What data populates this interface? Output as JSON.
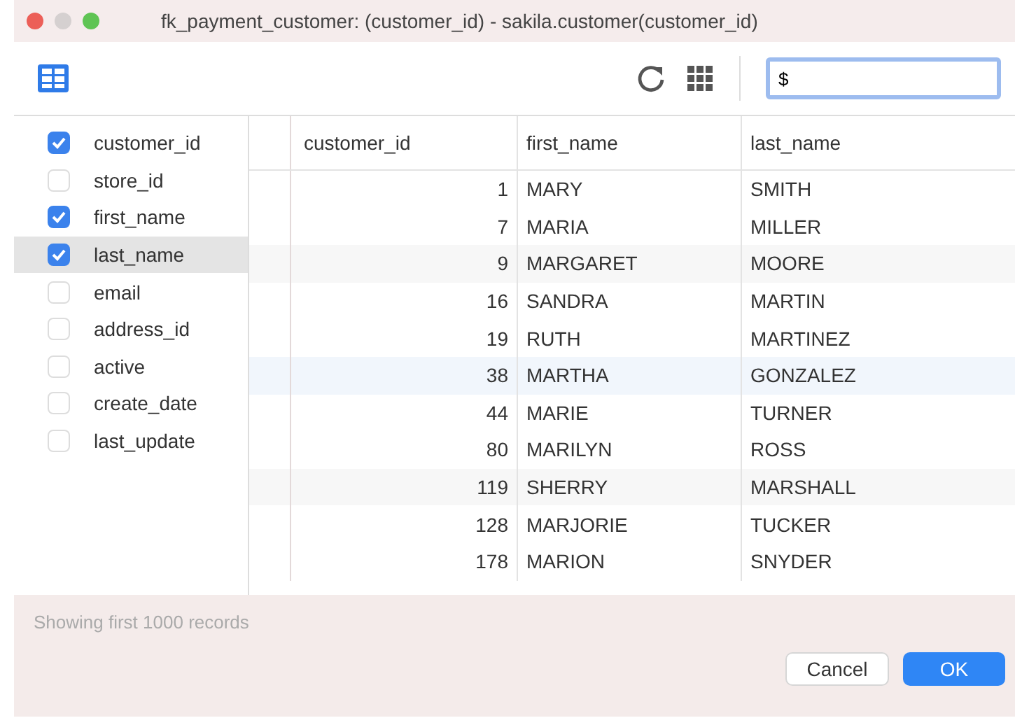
{
  "window": {
    "title": "fk_payment_customer: (customer_id) - sakila.customer(customer_id)"
  },
  "search": {
    "value": "$"
  },
  "columns": [
    {
      "name": "customer_id",
      "checked": true,
      "selected": false
    },
    {
      "name": "store_id",
      "checked": false,
      "selected": false
    },
    {
      "name": "first_name",
      "checked": true,
      "selected": false
    },
    {
      "name": "last_name",
      "checked": true,
      "selected": true
    },
    {
      "name": "email",
      "checked": false,
      "selected": false
    },
    {
      "name": "address_id",
      "checked": false,
      "selected": false
    },
    {
      "name": "active",
      "checked": false,
      "selected": false
    },
    {
      "name": "create_date",
      "checked": false,
      "selected": false
    },
    {
      "name": "last_update",
      "checked": false,
      "selected": false
    }
  ],
  "table": {
    "columns": [
      "customer_id",
      "first_name",
      "last_name"
    ],
    "rows": [
      [
        "1",
        "MARY",
        "SMITH"
      ],
      [
        "7",
        "MARIA",
        "MILLER"
      ],
      [
        "9",
        "MARGARET",
        "MOORE"
      ],
      [
        "16",
        "SANDRA",
        "MARTIN"
      ],
      [
        "19",
        "RUTH",
        "MARTINEZ"
      ],
      [
        "38",
        "MARTHA",
        "GONZALEZ"
      ],
      [
        "44",
        "MARIE",
        "TURNER"
      ],
      [
        "80",
        "MARILYN",
        "ROSS"
      ],
      [
        "119",
        "SHERRY",
        "MARSHALL"
      ],
      [
        "128",
        "MARJORIE",
        "TUCKER"
      ],
      [
        "178",
        "MARION",
        "SNYDER"
      ]
    ]
  },
  "status": "Showing first 1000 records",
  "buttons": [
    {
      "label": "Cancel",
      "kind": "secondary"
    },
    {
      "label": "OK",
      "kind": "primary"
    }
  ]
}
